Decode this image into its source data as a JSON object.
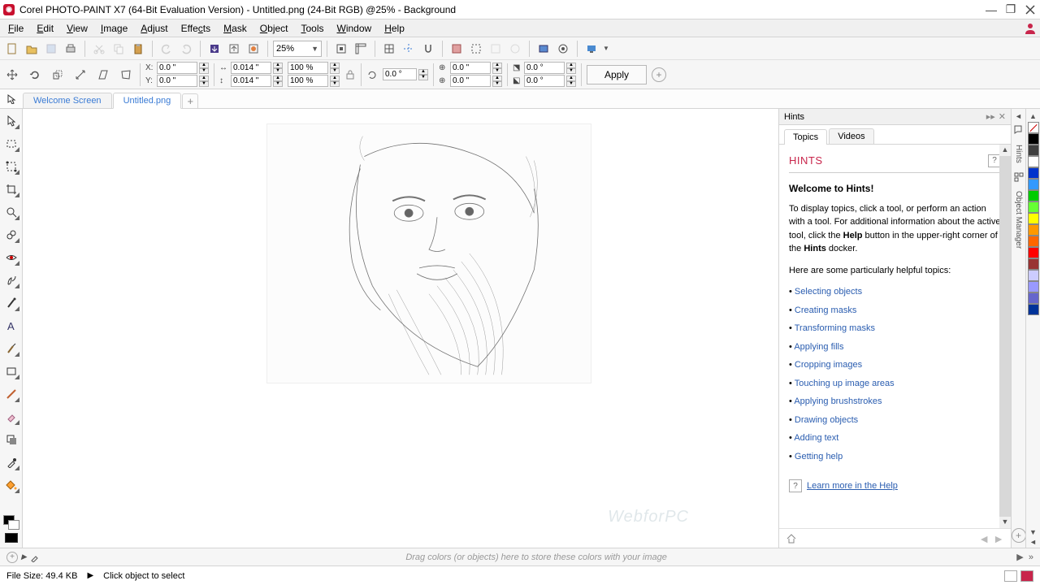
{
  "window": {
    "title": "Corel PHOTO-PAINT X7 (64-Bit Evaluation Version) - Untitled.png (24-Bit RGB) @25% - Background"
  },
  "menu": {
    "items": [
      "File",
      "Edit",
      "View",
      "Image",
      "Adjust",
      "Effects",
      "Mask",
      "Object",
      "Tools",
      "Window",
      "Help"
    ]
  },
  "toolbar1": {
    "zoom": "25%"
  },
  "propbar": {
    "x": "0.0 \"",
    "y": "0.0 \"",
    "w": "0.014 \"",
    "h": "0.014 \"",
    "sx": "100 %",
    "sy": "100 %",
    "rot": "0.0 °",
    "cx": "0.0 \"",
    "cy": "0.0 \"",
    "skx": "0.0 °",
    "sky": "0.0 °",
    "apply": "Apply"
  },
  "tabs": {
    "items": [
      "Welcome Screen",
      "Untitled.png"
    ],
    "active": 1
  },
  "hints": {
    "docker_title": "Hints",
    "tab_topics": "Topics",
    "tab_videos": "Videos",
    "heading": "HINTS",
    "welcome": "Welcome to Hints!",
    "para1a": "To display topics, click a tool, or perform an action with a tool. For additional information about the active tool, click the ",
    "help_word": "Help",
    "para1b": " button in the upper-right corner of the ",
    "hints_word": "Hints",
    "para1c": " docker.",
    "para2": "Here are some particularly helpful topics:",
    "topics": [
      "Selecting objects",
      "Creating masks",
      "Transforming masks",
      "Applying fills",
      "Cropping images",
      "Touching up image areas",
      "Applying brushstrokes",
      "Drawing objects",
      "Adding text",
      "Getting help"
    ],
    "learn_more": "Learn more in the Help"
  },
  "side_tabs": {
    "hints": "Hints",
    "obj": "Object Manager"
  },
  "palette": {
    "colors": [
      "#000000",
      "#404040",
      "#ffffff",
      "#0033cc",
      "#3399ff",
      "#00cc00",
      "#66ff33",
      "#ffff00",
      "#ff9900",
      "#ff6600",
      "#ff0000",
      "#993333",
      "#ccccff",
      "#9999ff",
      "#6666cc",
      "#003399"
    ]
  },
  "colorwell_bar": {
    "msg": "Drag colors (or objects) here to store these colors with your image"
  },
  "status": {
    "filesize": "File Size: 49.4 KB",
    "hint": "Click object to select"
  },
  "canvas_placeholder": "sketch image"
}
